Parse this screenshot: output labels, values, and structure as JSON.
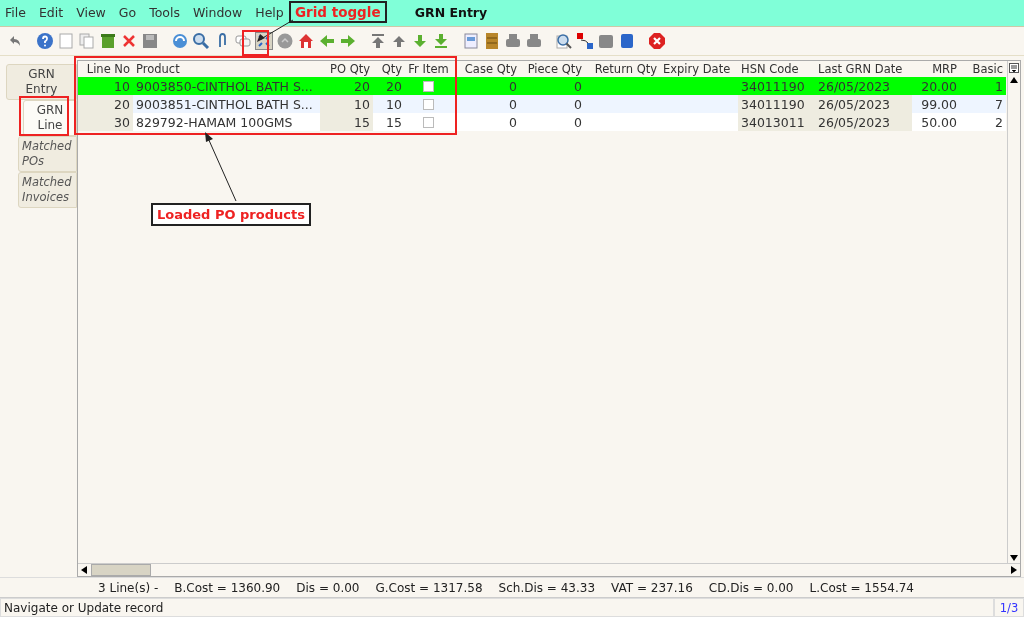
{
  "menu": [
    "File",
    "Edit",
    "View",
    "Go",
    "Tools",
    "Window",
    "Help"
  ],
  "window": {
    "title": "GRN Entry"
  },
  "tabs": [
    {
      "label": "GRN Entry",
      "selected": false,
      "disabled": false
    },
    {
      "label": "GRN Line",
      "selected": true,
      "disabled": false
    },
    {
      "label": "Matched POs",
      "selected": false,
      "disabled": true
    },
    {
      "label": "Matched Invoices",
      "selected": false,
      "disabled": true
    }
  ],
  "table": {
    "columns": [
      "Line No",
      "Product",
      "PO Qty",
      "Qty",
      "Fr Item",
      "Case Qty",
      "Piece Qty",
      "Return Qty",
      "Expiry Date",
      "HSN Code",
      "Last GRN Date",
      "MRP",
      "Basic"
    ],
    "rows": [
      {
        "selected": true,
        "fr_item": false,
        "cells": [
          "10",
          "9003850-CINTHOL BATH S...",
          "20",
          "20",
          "",
          "0",
          "0",
          "",
          "",
          "34011190",
          "26/05/2023",
          "20.00",
          "1"
        ]
      },
      {
        "selected": false,
        "fr_item": false,
        "cells": [
          "20",
          "9003851-CINTHOL BATH S...",
          "10",
          "10",
          "",
          "0",
          "0",
          "",
          "",
          "34011190",
          "26/05/2023",
          "99.00",
          "7"
        ]
      },
      {
        "selected": false,
        "fr_item": false,
        "cells": [
          "30",
          "829792-HAMAM 100GMS",
          "15",
          "15",
          "",
          "0",
          "0",
          "",
          "",
          "34013011",
          "26/05/2023",
          "50.00",
          "2"
        ]
      }
    ]
  },
  "summary": [
    "3 Line(s) -",
    "B.Cost = 1360.90",
    "Dis = 0.00",
    "G.Cost = 1317.58",
    "Sch.Dis = 43.33",
    "VAT = 237.16",
    "CD.Dis = 0.00",
    "L.Cost = 1554.74"
  ],
  "status_bar": {
    "message": "Navigate or Update record",
    "record": "1/3"
  },
  "annotations": [
    {
      "kind": "callout",
      "label": "Grid toggle"
    },
    {
      "kind": "label",
      "label": "Loaded PO products"
    }
  ]
}
